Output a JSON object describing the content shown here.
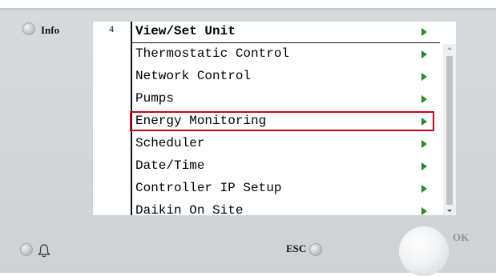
{
  "panel": {
    "info_label": "Info",
    "esc_label": "ESC",
    "ok_label": "OK"
  },
  "screen": {
    "menu_number": "4",
    "title": "View/Set Unit",
    "items": [
      {
        "label": "Thermostatic Control"
      },
      {
        "label": "Network Control"
      },
      {
        "label": "Pumps"
      },
      {
        "label": "Energy Monitoring",
        "selected": true
      },
      {
        "label": "Scheduler"
      },
      {
        "label": "Date/Time"
      },
      {
        "label": "Controller IP Setup"
      },
      {
        "label": "Daikin On Site"
      }
    ]
  },
  "colors": {
    "arrow": "#2b8a2b",
    "highlight": "#d0021b"
  }
}
